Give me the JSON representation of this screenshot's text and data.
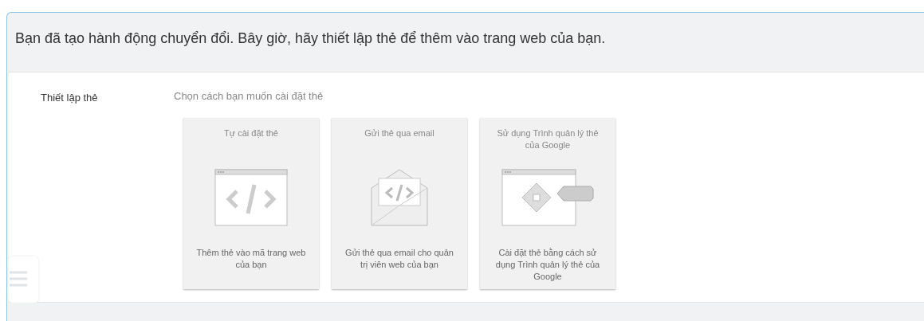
{
  "heading": "Bạn đã tạo hành động chuyển đổi. Bây giờ, hãy thiết lập thẻ để thêm vào trang web của bạn.",
  "section": {
    "label": "Thiết lập thẻ",
    "prompt": "Chọn cách bạn muốn cài đặt thẻ",
    "options": [
      {
        "kind": "code",
        "title": "Tự cài đặt thẻ",
        "description": "Thêm thẻ vào mã trang web của bạn"
      },
      {
        "kind": "email",
        "title": "Gửi thẻ qua email",
        "description": "Gửi thẻ qua email cho quản trị viên web của bạn"
      },
      {
        "kind": "tagmanager",
        "title": "Sử dụng Trình quản lý thẻ của Google",
        "description": "Cài đặt thẻ bằng cách sử dụng Trình quản lý thẻ của Google"
      }
    ]
  }
}
